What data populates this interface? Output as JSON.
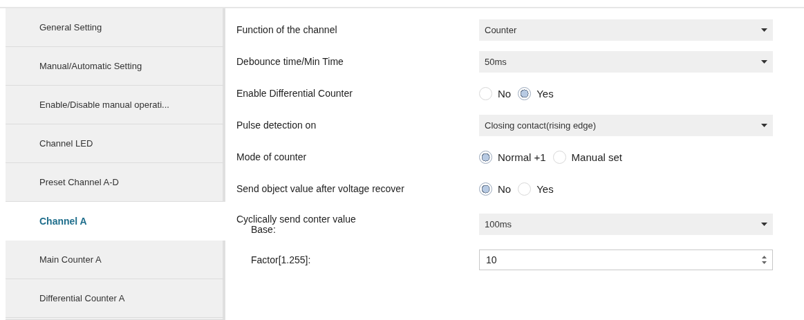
{
  "sidebar": {
    "items": [
      {
        "label": "General Setting",
        "selected": false
      },
      {
        "label": "Manual/Automatic Setting",
        "selected": false
      },
      {
        "label": "Enable/Disable manual operati...",
        "selected": false
      },
      {
        "label": "Channel LED",
        "selected": false
      },
      {
        "label": "Preset Channel A-D",
        "selected": false
      },
      {
        "label": "Channel A",
        "selected": true
      },
      {
        "label": "Main Counter A",
        "selected": false
      },
      {
        "label": "Differential Counter A",
        "selected": false
      }
    ]
  },
  "parameters": [
    {
      "kind": "dropdown",
      "label": "Function of the channel",
      "value": "Counter"
    },
    {
      "kind": "dropdown",
      "label": "Debounce time/Min Time",
      "value": "50ms"
    },
    {
      "kind": "radio",
      "label": "Enable Differential Counter",
      "options": [
        {
          "label": "No",
          "selected": false
        },
        {
          "label": "Yes",
          "selected": true
        }
      ]
    },
    {
      "kind": "dropdown",
      "label": "Pulse detection on",
      "value": "Closing contact(rising edge)"
    },
    {
      "kind": "radio",
      "label": "Mode of counter",
      "options": [
        {
          "label": "Normal +1",
          "selected": true
        },
        {
          "label": "Manual set",
          "selected": false
        }
      ]
    },
    {
      "kind": "radio",
      "label": "Send object value after voltage recover",
      "options": [
        {
          "label": "No",
          "selected": true
        },
        {
          "label": "Yes",
          "selected": false
        }
      ]
    },
    {
      "kind": "dropdown",
      "label": "Cyclically send conter value",
      "sublabel": "Base:",
      "value": "100ms"
    },
    {
      "kind": "spin",
      "label": "Factor[1.255]:",
      "value": "10"
    }
  ]
}
